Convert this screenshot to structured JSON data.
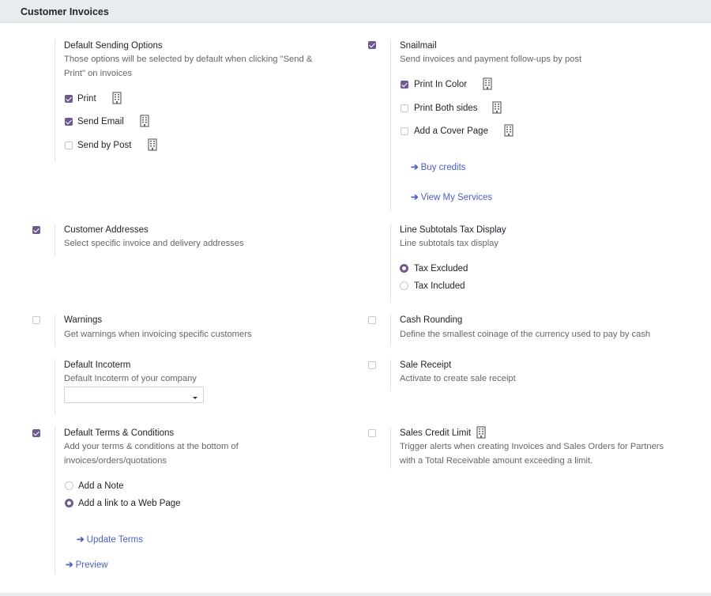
{
  "section": {
    "title": "Customer Invoices"
  },
  "default_sending": {
    "title": "Default Sending Options",
    "desc_line1": "Those options will be selected by default when clicking \"Send &",
    "desc_line2": "Print\" on invoices",
    "options": [
      {
        "label": "Print",
        "checked": true
      },
      {
        "label": "Send Email",
        "checked": true
      },
      {
        "label": "Send by Post",
        "checked": false
      }
    ]
  },
  "snailmail": {
    "title": "Snailmail",
    "enabled": true,
    "desc": "Send invoices and payment follow-ups by post",
    "options": [
      {
        "label": "Print In Color",
        "checked": true
      },
      {
        "label": "Print Both sides",
        "checked": false
      },
      {
        "label": "Add a Cover Page",
        "checked": false
      }
    ],
    "links": [
      "Buy credits",
      "View My Services"
    ]
  },
  "customer_addresses": {
    "title": "Customer Addresses",
    "enabled": true,
    "desc": "Select specific invoice and delivery addresses"
  },
  "line_subtotals": {
    "title": "Line Subtotals Tax Display",
    "desc": "Line subtotals tax display",
    "options": [
      {
        "label": "Tax Excluded",
        "selected": true
      },
      {
        "label": "Tax Included",
        "selected": false
      }
    ]
  },
  "warnings": {
    "title": "Warnings",
    "enabled": false,
    "desc": "Get warnings when invoicing specific customers"
  },
  "cash_rounding": {
    "title": "Cash Rounding",
    "enabled": false,
    "desc": "Define the smallest coinage of the currency used to pay by cash"
  },
  "incoterm": {
    "title": "Default Incoterm",
    "desc": "Default Incoterm of your company",
    "value": ""
  },
  "sale_receipt": {
    "title": "Sale Receipt",
    "enabled": false,
    "desc": "Activate to create sale receipt"
  },
  "terms": {
    "title": "Default Terms & Conditions",
    "enabled": true,
    "desc_line1": "Add your terms & conditions at the bottom of",
    "desc_line2": "invoices/orders/quotations",
    "options": [
      {
        "label": "Add a Note",
        "selected": false
      },
      {
        "label": "Add a link to a Web Page",
        "selected": true
      }
    ],
    "update_link": "Update Terms",
    "preview_link": "Preview"
  },
  "credit_limit": {
    "title": "Sales Credit Limit",
    "enabled": false,
    "desc_line1": "Trigger alerts when creating Invoices and Sales Orders for Partners",
    "desc_line2": "with a Total Receivable amount exceeding a limit."
  },
  "colors": {
    "accent": "#6e5a8f",
    "link": "#4a5fc1",
    "header_bg": "#e9ecef"
  },
  "icons": {
    "enterprise": "building-icon",
    "link_arrow": "arrow-right-icon"
  }
}
